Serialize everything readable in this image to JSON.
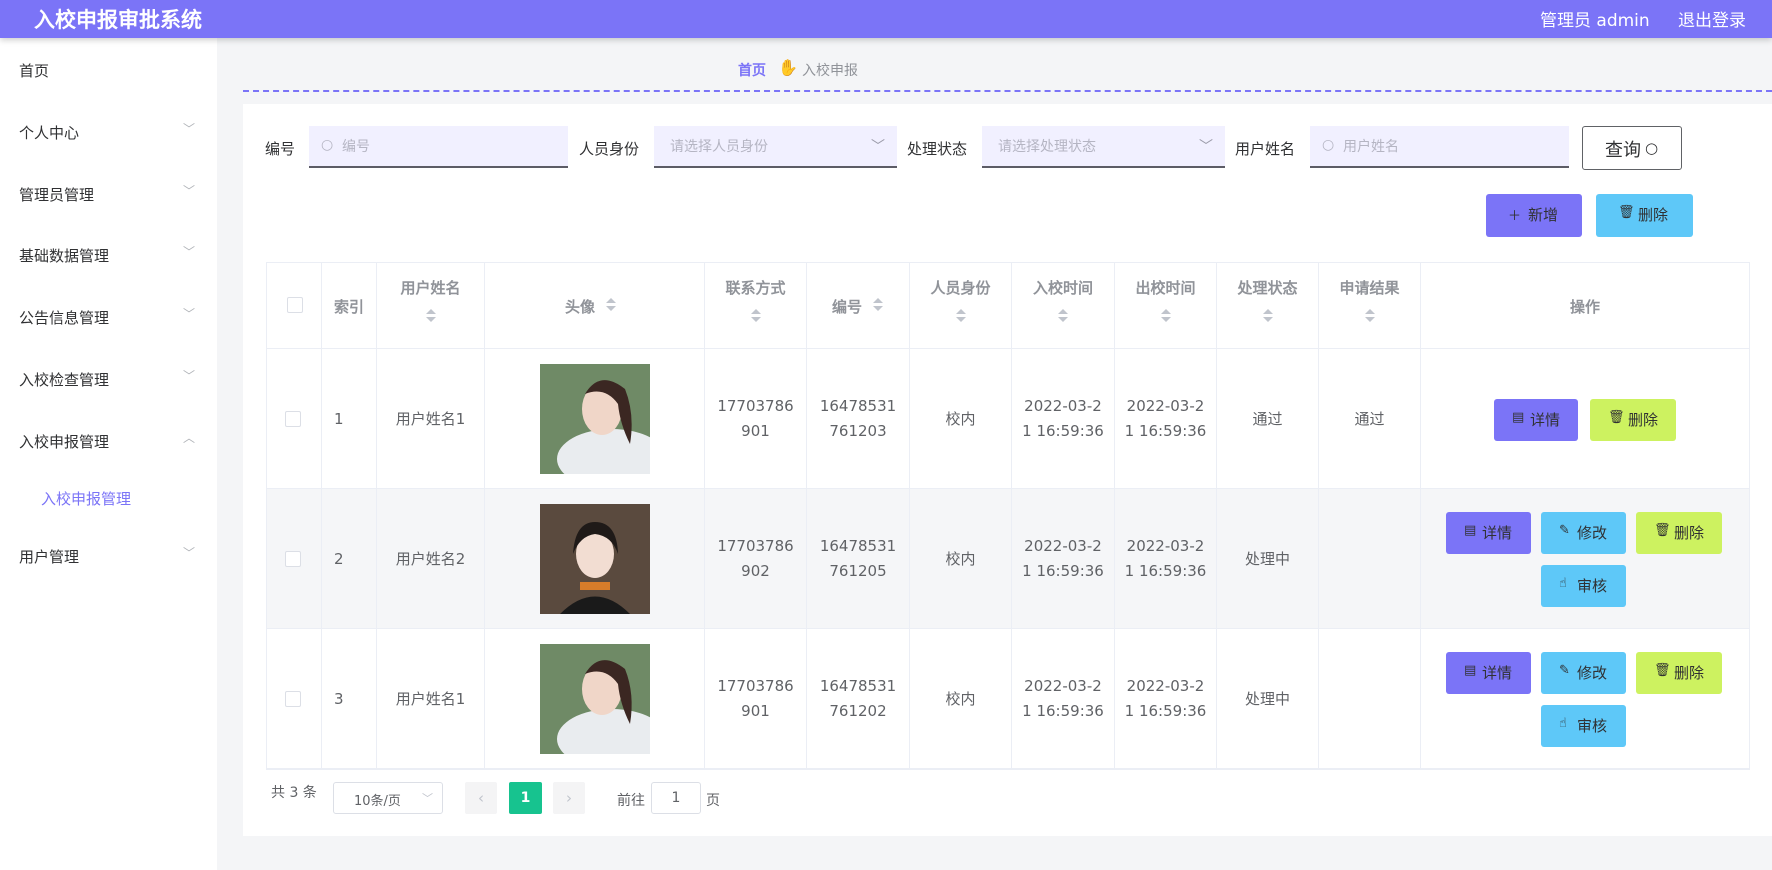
{
  "app": {
    "title": "入校申报审批系统",
    "admin": "管理员 admin",
    "logout": "退出登录"
  },
  "sidebar": {
    "items": [
      {
        "label": "首页"
      },
      {
        "label": "个人中心"
      },
      {
        "label": "管理员管理"
      },
      {
        "label": "基础数据管理"
      },
      {
        "label": "公告信息管理"
      },
      {
        "label": "入校检查管理"
      },
      {
        "label": "入校申报管理",
        "expanded": true,
        "children": [
          {
            "label": "入校申报管理",
            "active": true
          }
        ]
      },
      {
        "label": "用户管理"
      }
    ]
  },
  "breadcrumb": {
    "home": "首页",
    "current": "入校申报",
    "separator_icon": "hand-icon"
  },
  "filters": {
    "code": {
      "label": "编号",
      "placeholder": "编号"
    },
    "identity": {
      "label": "人员身份",
      "placeholder": "请选择人员身份"
    },
    "status": {
      "label": "处理状态",
      "placeholder": "请选择处理状态"
    },
    "username": {
      "label": "用户姓名",
      "placeholder": "用户姓名"
    },
    "query": "查询"
  },
  "actions": {
    "add": "新增",
    "delete": "删除"
  },
  "table": {
    "headers": [
      "索引",
      "用户姓名",
      "头像",
      "联系方式",
      "编号",
      "人员身份",
      "入校时间",
      "出校时间",
      "处理状态",
      "申请结果",
      "操作"
    ],
    "rows": [
      {
        "index": "1",
        "name": "用户姓名1",
        "avatar": "photo-girl-side",
        "phone1": "17703786",
        "phone2": "901",
        "code1": "16478531",
        "code2": "761203",
        "identity": "校内",
        "in1": "2022-03-2",
        "in2": "1 16:59:36",
        "out1": "2022-03-2",
        "out2": "1 16:59:36",
        "status": "通过",
        "result": "通过",
        "ops": [
          "详情",
          "删除"
        ]
      },
      {
        "index": "2",
        "name": "用户姓名2",
        "avatar": "photo-girl-front",
        "phone1": "17703786",
        "phone2": "902",
        "code1": "16478531",
        "code2": "761205",
        "identity": "校内",
        "in1": "2022-03-2",
        "in2": "1 16:59:36",
        "out1": "2022-03-2",
        "out2": "1 16:59:36",
        "status": "处理中",
        "result": "",
        "ops": [
          "详情",
          "修改",
          "删除",
          "审核"
        ]
      },
      {
        "index": "3",
        "name": "用户姓名1",
        "avatar": "photo-girl-side",
        "phone1": "17703786",
        "phone2": "901",
        "code1": "16478531",
        "code2": "761202",
        "identity": "校内",
        "in1": "2022-03-2",
        "in2": "1 16:59:36",
        "out1": "2022-03-2",
        "out2": "1 16:59:36",
        "status": "处理中",
        "result": "",
        "ops": [
          "详情",
          "修改",
          "删除",
          "审核"
        ]
      }
    ]
  },
  "pagination": {
    "total": "共 3 条",
    "page_size": "10条/页",
    "current": "1",
    "goto_prefix": "前往",
    "goto_value": "1",
    "goto_suffix": "页"
  },
  "colors": {
    "primary": "#7b74f7",
    "info": "#5ec8f8",
    "warning": "#cdf260",
    "success": "#17c38f"
  }
}
